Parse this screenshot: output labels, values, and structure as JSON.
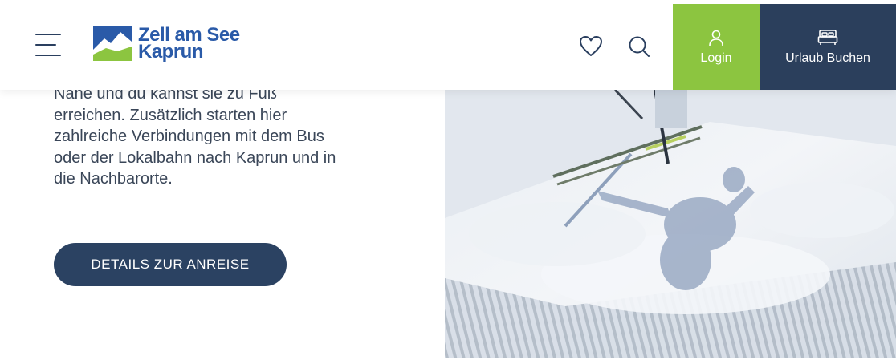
{
  "header": {
    "logo": {
      "line1": "Zell am See",
      "line2": "Kaprun"
    },
    "menu_icon": "hamburger-menu-icon",
    "favorites_icon": "heart-icon",
    "search_icon": "search-icon",
    "login": {
      "label": "Login",
      "icon": "user-icon",
      "color": "#8cc540"
    },
    "booking": {
      "label": "Urlaub Buchen",
      "icon": "bed-icon",
      "color": "#2b3f5c"
    }
  },
  "main": {
    "lines": [
      "Nähe und du kannst sie zu Fuß",
      "erreichen. Zusätzlich starten hier",
      "zahlreiche Verbindungen mit dem Bus",
      "oder der Lokalbahn nach Kaprun und in",
      "die Nachbarorte."
    ],
    "cta_label": "DETAILS ZUR ANREISE",
    "cta_color": "#2b4262"
  },
  "image": {
    "subject": "skier-shadow-on-groomed-snow"
  }
}
